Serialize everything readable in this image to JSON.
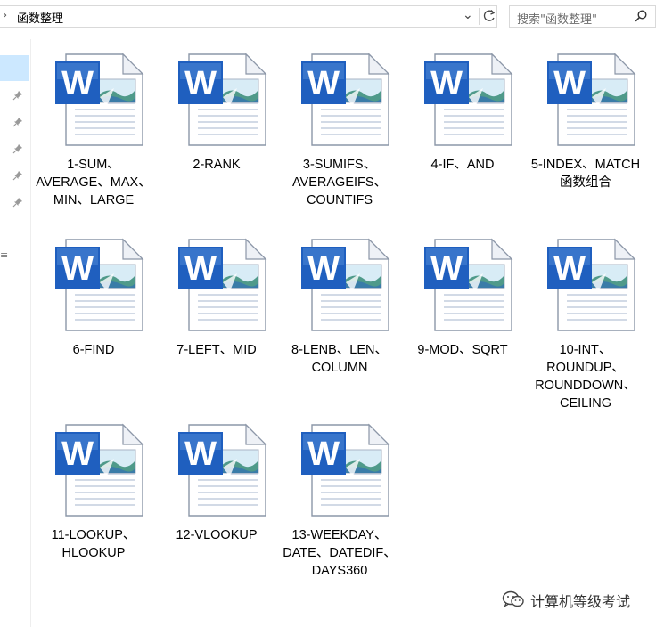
{
  "address_bar": {
    "breadcrumb": "函数整理",
    "chevron_icon": "chevron-right-icon",
    "dropdown_icon": "chevron-down-icon",
    "refresh_icon": "refresh-icon"
  },
  "search": {
    "placeholder": "搜索\"函数整理\"",
    "icon": "search-icon"
  },
  "nav": {
    "pin_icon": "pin-icon",
    "letter": "≡"
  },
  "files": [
    {
      "name": "1-SUM、AVERAGE、MAX、MIN、LARGE",
      "icon": "word-document-icon"
    },
    {
      "name": "2-RANK",
      "icon": "word-document-icon"
    },
    {
      "name": "3-SUMIFS、AVERAGEIFS、COUNTIFS",
      "icon": "word-document-icon"
    },
    {
      "name": "4-IF、AND",
      "icon": "word-document-icon"
    },
    {
      "name": "5-INDEX、MATCH函数组合",
      "icon": "word-document-icon"
    },
    {
      "name": "6-FIND",
      "icon": "word-document-icon"
    },
    {
      "name": "7-LEFT、MID",
      "icon": "word-document-icon"
    },
    {
      "name": "8-LENB、LEN、COLUMN",
      "icon": "word-document-icon"
    },
    {
      "name": "9-MOD、SQRT",
      "icon": "word-document-icon"
    },
    {
      "name": "10-INT、ROUNDUP、ROUNDDOWN、CEILING",
      "icon": "word-document-icon"
    },
    {
      "name": "11-LOOKUP、HLOOKUP",
      "icon": "word-document-icon"
    },
    {
      "name": "12-VLOOKUP",
      "icon": "word-document-icon"
    },
    {
      "name": "13-WEEKDAY、DATE、DATEDIF、DAYS360",
      "icon": "word-document-icon"
    }
  ],
  "watermark": {
    "text": "计算机等级考试",
    "icon": "wechat-icon"
  },
  "colors": {
    "word_blue": "#1f5fbf",
    "selection": "#cce8ff",
    "border": "#d9d9d9"
  }
}
